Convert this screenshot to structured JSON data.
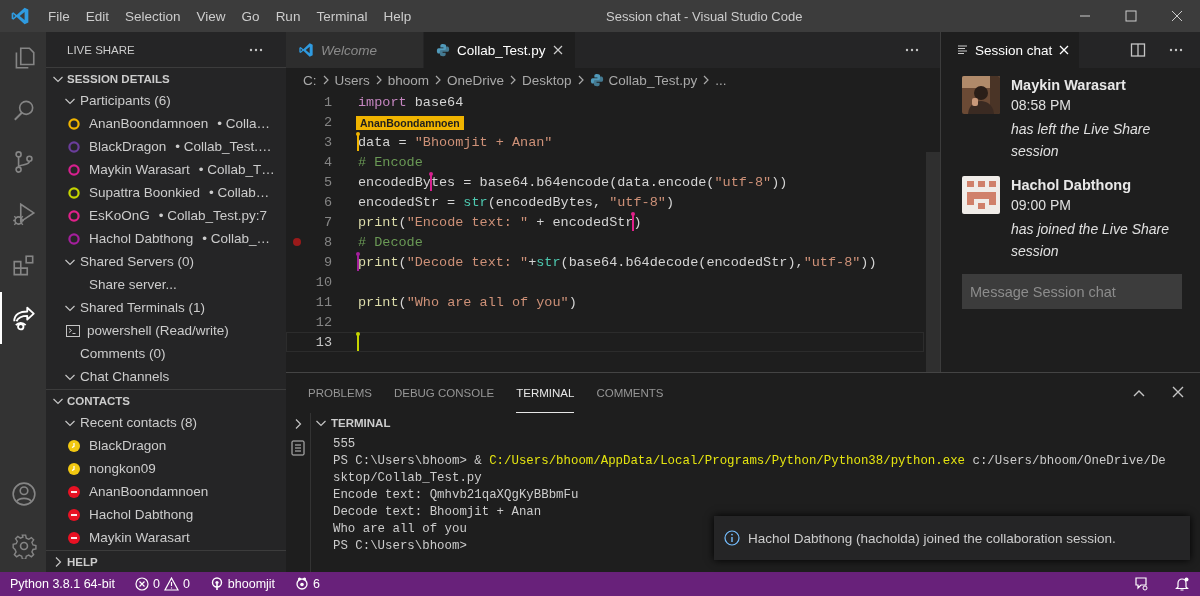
{
  "window": {
    "title": "Session chat - Visual Studio Code"
  },
  "menu": [
    "File",
    "Edit",
    "Selection",
    "View",
    "Go",
    "Run",
    "Terminal",
    "Help"
  ],
  "activity_bar": {
    "top": [
      {
        "kind": "explorer",
        "selected": false
      },
      {
        "kind": "search",
        "selected": false
      },
      {
        "kind": "source-control",
        "selected": false
      },
      {
        "kind": "run-debug",
        "selected": false
      },
      {
        "kind": "extensions",
        "selected": false
      },
      {
        "kind": "live-share",
        "selected": true
      }
    ],
    "bottom": [
      {
        "kind": "account",
        "selected": false
      },
      {
        "kind": "settings",
        "selected": false
      }
    ]
  },
  "sidebar": {
    "title": "LIVE SHARE",
    "sections": [
      {
        "label": "SESSION DETAILS",
        "expanded": true,
        "children": [
          {
            "label": "Participants (6)",
            "expanded": true,
            "children": [
              {
                "kind": "participant",
                "label": "AnanBoondamnoen",
                "detail": "• Colla…",
                "color": "#f0b400"
              },
              {
                "kind": "participant",
                "label": "BlackDragon",
                "detail": "• Collab_Test.…",
                "color": "#6a3d9a"
              },
              {
                "kind": "participant",
                "label": "Maykin Warasart",
                "detail": "• Collab_T…",
                "color": "#d6208e"
              },
              {
                "kind": "participant",
                "label": "Supattra Boonkied",
                "detail": "• Collab…",
                "color": "#c5d400"
              },
              {
                "kind": "participant",
                "label": "EsKoOnG",
                "detail": "• Collab_Test.py:7",
                "color": "#e0218a"
              },
              {
                "kind": "participant",
                "label": "Hachol Dabthong",
                "detail": "• Collab_…",
                "color": "#a41f9c"
              }
            ]
          },
          {
            "label": "Shared Servers (0)",
            "expanded": true,
            "children": [
              {
                "kind": "action",
                "label": "Share server..."
              }
            ]
          },
          {
            "label": "Shared Terminals (1)",
            "expanded": true,
            "children": [
              {
                "kind": "terminal",
                "label": "powershell (Read/write)"
              }
            ]
          },
          {
            "label": "Comments (0)"
          },
          {
            "label": "Chat Channels",
            "expanded": true
          }
        ]
      },
      {
        "label": "CONTACTS",
        "expanded": true,
        "children": [
          {
            "label": "Recent contacts (8)",
            "expanded": true,
            "children": [
              {
                "kind": "away-contact",
                "label": "BlackDragon",
                "color": "#f2c811"
              },
              {
                "kind": "away-contact",
                "label": "nongkon09",
                "color": "#f2c811"
              },
              {
                "kind": "busy-contact",
                "label": "AnanBoondamnoen",
                "color": "#e81123"
              },
              {
                "kind": "busy-contact",
                "label": "Hachol Dabthong",
                "color": "#e81123"
              },
              {
                "kind": "busy-contact",
                "label": "Maykin Warasart",
                "color": "#e81123"
              }
            ]
          }
        ]
      },
      {
        "label": "HELP",
        "expanded": false
      }
    ]
  },
  "editor": {
    "tabs": [
      {
        "label": "Welcome",
        "kind": "welcome",
        "preview": true,
        "selected": false
      },
      {
        "label": "Collab_Test.py",
        "kind": "python",
        "preview": false,
        "selected": true
      }
    ],
    "breadcrumbs": [
      {
        "label": "C:",
        "kind": "folder"
      },
      {
        "label": "Users",
        "kind": "folder"
      },
      {
        "label": "bhoom",
        "kind": "folder"
      },
      {
        "label": "OneDrive",
        "kind": "folder"
      },
      {
        "label": "Desktop",
        "kind": "folder"
      },
      {
        "label": "Collab_Test.py",
        "kind": "python"
      },
      {
        "label": "...",
        "kind": "more"
      }
    ],
    "lines": [
      {
        "number": "1",
        "tokens": [
          {
            "kind": "keyword",
            "text": "import"
          },
          {
            "kind": "plain",
            "text": " base64"
          }
        ]
      },
      {
        "number": "2"
      },
      {
        "number": "3",
        "tokens": [
          {
            "kind": "plain",
            "text": "data = ",
            "cursor": {
              "color": "#f0b400",
              "flag": "AnanBoondamnoen"
            }
          },
          {
            "kind": "string",
            "text": "\"Bhoomjit + Anan\""
          }
        ]
      },
      {
        "number": "4",
        "tokens": [
          {
            "kind": "comment",
            "text": "# Encode"
          }
        ]
      },
      {
        "number": "5",
        "tokens": [
          {
            "kind": "plain",
            "text": "encodedBy"
          },
          {
            "kind": "plain",
            "text": "tes = base64.b64encode(data.encode(",
            "cursor": {
              "color": "#d6208e"
            }
          },
          {
            "kind": "string",
            "text": "\"utf-8\""
          },
          {
            "kind": "plain",
            "text": "))"
          }
        ]
      },
      {
        "number": "6",
        "tokens": [
          {
            "kind": "plain",
            "text": "encodedStr = "
          },
          {
            "kind": "builtin",
            "text": "str"
          },
          {
            "kind": "plain",
            "text": "(encodedBytes, "
          },
          {
            "kind": "string",
            "text": "\"utf-8\""
          },
          {
            "kind": "plain",
            "text": ")"
          }
        ]
      },
      {
        "number": "7",
        "tokens": [
          {
            "kind": "function",
            "text": "print"
          },
          {
            "kind": "plain",
            "text": "("
          },
          {
            "kind": "string",
            "text": "\"Encode text: \""
          },
          {
            "kind": "plain",
            "text": " + encodedStr"
          },
          {
            "kind": "plain",
            "text": ")",
            "cursor": {
              "color": "#e0218a"
            }
          }
        ]
      },
      {
        "number": "8",
        "breakpoint": true,
        "tokens": [
          {
            "kind": "comment",
            "text": "# Decode"
          }
        ]
      },
      {
        "number": "9",
        "tokens": [
          {
            "kind": "function",
            "text": "print",
            "cursor": {
              "color": "#a41f9c"
            }
          },
          {
            "kind": "plain",
            "text": "("
          },
          {
            "kind": "string",
            "text": "\"Decode text: \""
          },
          {
            "kind": "plain",
            "text": "+"
          },
          {
            "kind": "builtin",
            "text": "str"
          },
          {
            "kind": "plain",
            "text": "(base64.b64decode(encodedStr),"
          },
          {
            "kind": "string",
            "text": "\"utf-8\""
          },
          {
            "kind": "plain",
            "text": "))"
          }
        ]
      },
      {
        "number": "10"
      },
      {
        "number": "11",
        "tokens": [
          {
            "kind": "function",
            "text": "print"
          },
          {
            "kind": "plain",
            "text": "("
          },
          {
            "kind": "string",
            "text": "\"Who are all of you\""
          },
          {
            "kind": "plain",
            "text": ")"
          }
        ]
      },
      {
        "number": "12"
      },
      {
        "number": "13",
        "current": true,
        "cursor": {
          "color": "#c5d400"
        }
      }
    ]
  },
  "chat": {
    "tab": "Session chat",
    "messages": [
      {
        "author": "Maykin Warasart",
        "time": "08:58 PM",
        "text": "has left the Live Share session",
        "kind": "picture"
      },
      {
        "author": "Hachol Dabthong",
        "time": "09:00 PM",
        "text": "has joined the Live Share session",
        "kind": "identicon"
      }
    ],
    "input": {
      "placeholder": "Message Session chat"
    }
  },
  "panel": {
    "tabs": [
      {
        "label": "PROBLEMS",
        "selected": false
      },
      {
        "label": "DEBUG CONSOLE",
        "selected": false
      },
      {
        "label": "TERMINAL",
        "selected": true
      },
      {
        "label": "COMMENTS",
        "selected": false
      }
    ],
    "section": {
      "label": "TERMINAL",
      "expanded": true
    },
    "terminal": [
      [
        {
          "kind": "plain",
          "text": "555"
        }
      ],
      [
        {
          "kind": "plain",
          "text": "PS C:\\Users\\bhoom> & "
        },
        {
          "kind": "path",
          "text": "C:/Users/bhoom/AppData/Local/Programs/Python/Python38/python.exe"
        },
        {
          "kind": "plain",
          "text": " c:/Users/bhoom/OneDrive/De"
        }
      ],
      [
        {
          "kind": "plain",
          "text": "sktop/Collab_Test.py"
        }
      ],
      [
        {
          "kind": "plain",
          "text": "Encode text: Qmhvb21qaXQgKyBBbmFu"
        }
      ],
      [
        {
          "kind": "plain",
          "text": "Decode text: Bhoomjit + Anan"
        }
      ],
      [
        {
          "kind": "plain",
          "text": "Who are all of you"
        }
      ],
      [
        {
          "kind": "plain",
          "text": "PS C:\\Users\\bhoom>"
        }
      ]
    ],
    "notification": {
      "text": "Hachol Dabthong (hacholda) joined the collaboration session."
    }
  },
  "status_bar": {
    "items": [
      {
        "kind": "python",
        "label": "Python 3.8.1 64-bit"
      },
      {
        "kind": "problems",
        "errors": "0",
        "warnings": "0"
      },
      {
        "kind": "live-share",
        "label": "bhoomjit"
      },
      {
        "kind": "participants",
        "label": "6"
      }
    ]
  }
}
